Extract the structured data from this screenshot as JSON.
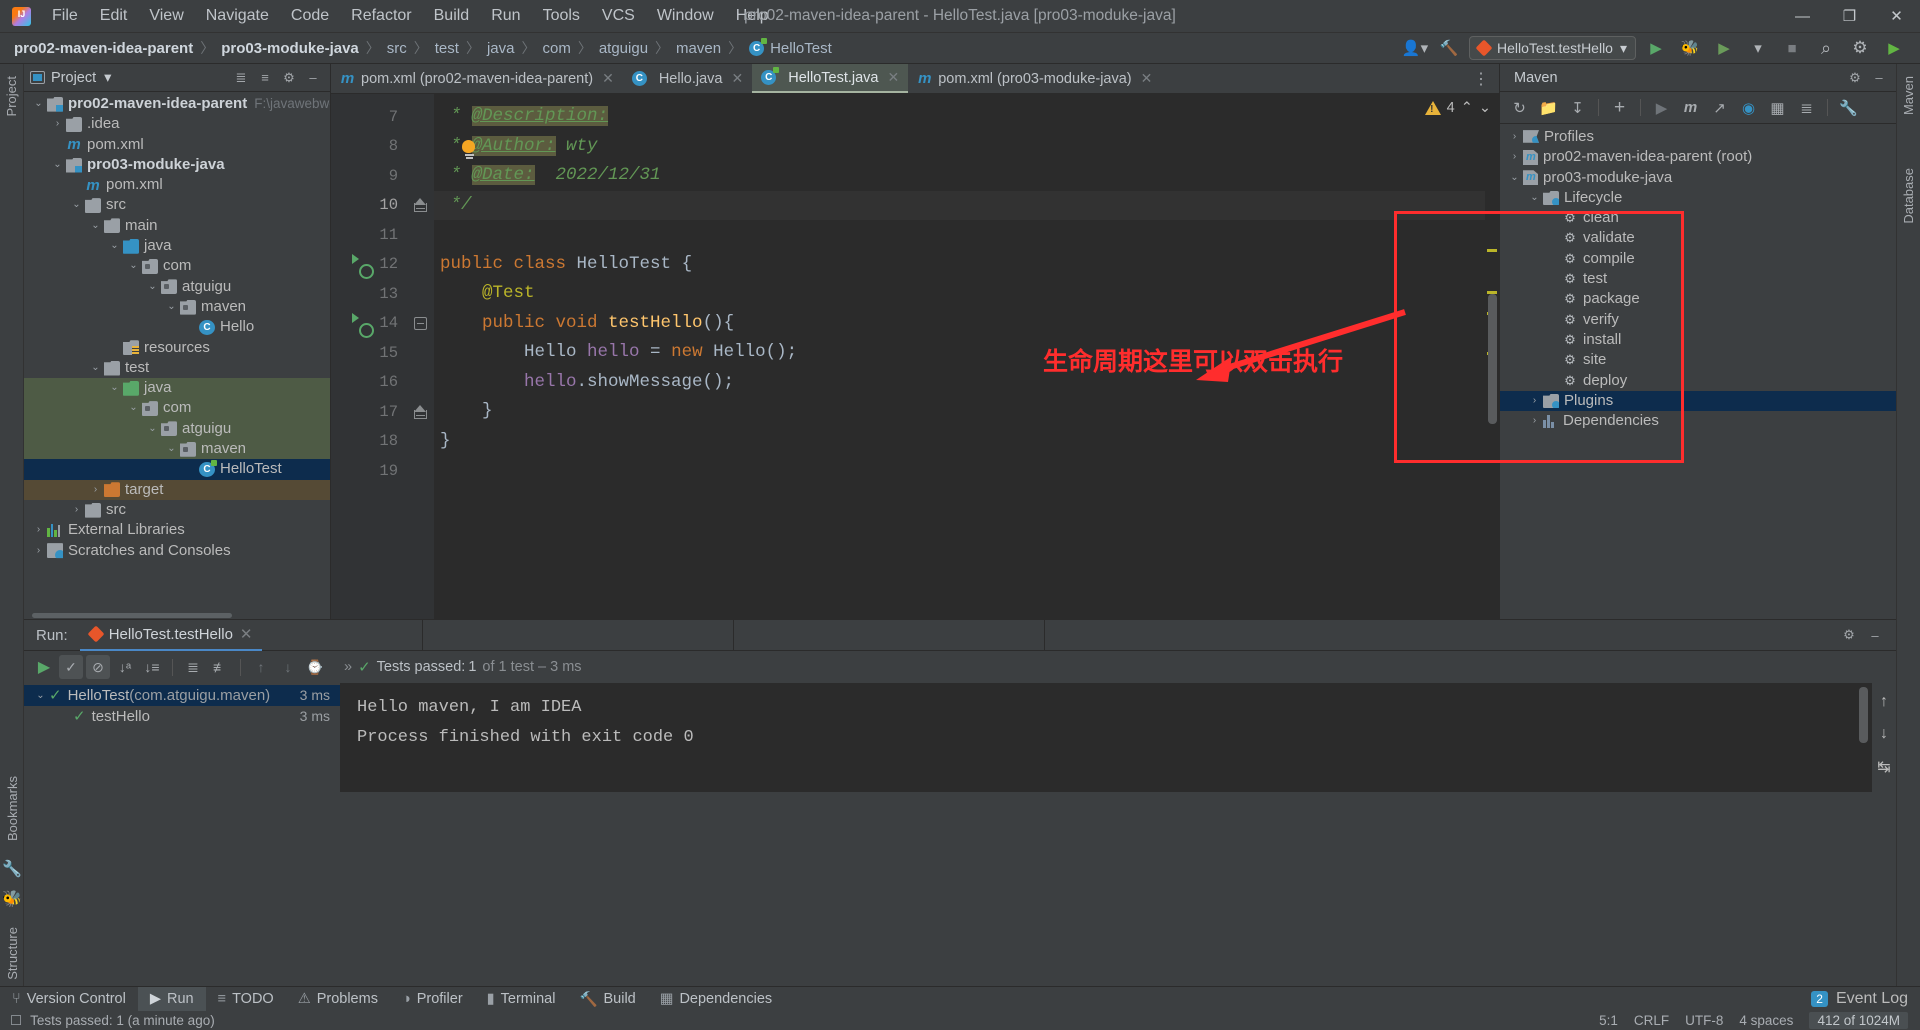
{
  "window": {
    "title": "pro02-maven-idea-parent - HelloTest.java [pro03-moduke-java]",
    "minimize": "—",
    "maximize": "❐",
    "close": "✕"
  },
  "menubar": {
    "items": [
      "File",
      "Edit",
      "View",
      "Navigate",
      "Code",
      "Refactor",
      "Build",
      "Run",
      "Tools",
      "VCS",
      "Window",
      "Help"
    ]
  },
  "navbar": {
    "crumbs": [
      "pro02-maven-idea-parent",
      "pro03-moduke-java",
      "src",
      "test",
      "java",
      "com",
      "atguigu",
      "maven",
      "HelloTest"
    ],
    "separator": "〉",
    "run_config": "HelloTest.testHello",
    "icons": {
      "profile": "user-icon",
      "build": "hammer-icon",
      "run": "▶",
      "debug": "debug-icon",
      "run_coverage": "coverage-icon",
      "more": "▾",
      "stop": "■",
      "search": "⌕",
      "settings": "⚙"
    }
  },
  "left_strip": {
    "top_label": "Project",
    "bottom_labels": [
      "Structure",
      "Bookmarks"
    ]
  },
  "right_strip": {
    "labels": [
      "Maven",
      "Database"
    ]
  },
  "project_panel": {
    "title": "Project",
    "dropdown": "▾",
    "actions": [
      "collapse-all-icon",
      "expand-all-icon",
      "settings-icon",
      "hide-icon"
    ],
    "tree": [
      {
        "depth": 0,
        "chev": "⌄",
        "icon": "module",
        "label": "pro02-maven-idea-parent",
        "bold": true,
        "path": "F:\\javawebwork\\",
        "state": ""
      },
      {
        "depth": 1,
        "chev": "›",
        "icon": "folder",
        "label": ".idea",
        "bold": false,
        "path": "",
        "state": ""
      },
      {
        "depth": 1,
        "chev": "",
        "icon": "maven-pom",
        "label": "pom.xml",
        "bold": false,
        "path": "",
        "state": ""
      },
      {
        "depth": 1,
        "chev": "⌄",
        "icon": "module",
        "label": "pro03-moduke-java",
        "bold": true,
        "path": "",
        "state": ""
      },
      {
        "depth": 2,
        "chev": "",
        "icon": "maven-pom",
        "label": "pom.xml",
        "bold": false,
        "path": "",
        "state": ""
      },
      {
        "depth": 2,
        "chev": "⌄",
        "icon": "folder",
        "label": "src",
        "bold": false,
        "path": "",
        "state": ""
      },
      {
        "depth": 3,
        "chev": "⌄",
        "icon": "folder",
        "label": "main",
        "bold": false,
        "path": "",
        "state": ""
      },
      {
        "depth": 4,
        "chev": "⌄",
        "icon": "folder-blue",
        "label": "java",
        "bold": false,
        "path": "",
        "state": ""
      },
      {
        "depth": 5,
        "chev": "⌄",
        "icon": "package",
        "label": "com",
        "bold": false,
        "path": "",
        "state": ""
      },
      {
        "depth": 6,
        "chev": "⌄",
        "icon": "package",
        "label": "atguigu",
        "bold": false,
        "path": "",
        "state": ""
      },
      {
        "depth": 7,
        "chev": "⌄",
        "icon": "package",
        "label": "maven",
        "bold": false,
        "path": "",
        "state": ""
      },
      {
        "depth": 8,
        "chev": "",
        "icon": "class",
        "label": "Hello",
        "bold": false,
        "path": "",
        "state": ""
      },
      {
        "depth": 4,
        "chev": "",
        "icon": "resources",
        "label": "resources",
        "bold": false,
        "path": "",
        "state": ""
      },
      {
        "depth": 3,
        "chev": "⌄",
        "icon": "folder",
        "label": "test",
        "bold": false,
        "path": "",
        "state": ""
      },
      {
        "depth": 4,
        "chev": "⌄",
        "icon": "folder-green",
        "label": "java",
        "bold": false,
        "path": "",
        "state": "green"
      },
      {
        "depth": 5,
        "chev": "⌄",
        "icon": "package",
        "label": "com",
        "bold": false,
        "path": "",
        "state": "green"
      },
      {
        "depth": 6,
        "chev": "⌄",
        "icon": "package",
        "label": "atguigu",
        "bold": false,
        "path": "",
        "state": "green"
      },
      {
        "depth": 7,
        "chev": "⌄",
        "icon": "package",
        "label": "maven",
        "bold": false,
        "path": "",
        "state": "green"
      },
      {
        "depth": 8,
        "chev": "",
        "icon": "class-test",
        "label": "HelloTest",
        "bold": false,
        "path": "",
        "state": "sel"
      },
      {
        "depth": 3,
        "chev": "›",
        "icon": "folder-orange",
        "label": "target",
        "bold": false,
        "path": "",
        "state": "brown"
      },
      {
        "depth": 2,
        "chev": "›",
        "icon": "folder",
        "label": "src",
        "bold": false,
        "path": "",
        "state": ""
      },
      {
        "depth": 0,
        "chev": "›",
        "icon": "libraries",
        "label": "External Libraries",
        "bold": false,
        "path": "",
        "state": ""
      },
      {
        "depth": 0,
        "chev": "›",
        "icon": "scratches",
        "label": "Scratches and Consoles",
        "bold": false,
        "path": "",
        "state": ""
      }
    ]
  },
  "editor": {
    "tabs": [
      {
        "label": "pom.xml (pro02-maven-idea-parent)",
        "icon": "maven-pom",
        "active": false,
        "close": "✕"
      },
      {
        "label": "Hello.java",
        "icon": "class",
        "active": false,
        "close": "✕"
      },
      {
        "label": "HelloTest.java",
        "icon": "class-test",
        "active": true,
        "close": "✕"
      },
      {
        "label": "pom.xml (pro03-moduke-java)",
        "icon": "maven-pom",
        "active": false,
        "close": "✕"
      }
    ],
    "tab_overflow": "⋮",
    "warning_count": "4",
    "warning_up": "⌃",
    "warning_down": "⌄",
    "lines": [
      {
        "num": "7",
        "mark": "",
        "fold": "",
        "highlight": false
      },
      {
        "num": "8",
        "mark": "",
        "fold": "",
        "highlight": false
      },
      {
        "num": "9",
        "mark": "",
        "fold": "",
        "highlight": false
      },
      {
        "num": "10",
        "mark": "",
        "fold": "foldtop",
        "highlight": true
      },
      {
        "num": "11",
        "mark": "",
        "fold": "",
        "highlight": false
      },
      {
        "num": "12",
        "mark": "run",
        "fold": "",
        "highlight": false
      },
      {
        "num": "13",
        "mark": "",
        "fold": "",
        "highlight": false
      },
      {
        "num": "14",
        "mark": "run",
        "fold": "minus",
        "highlight": false
      },
      {
        "num": "15",
        "mark": "",
        "fold": "",
        "highlight": false
      },
      {
        "num": "16",
        "mark": "",
        "fold": "",
        "highlight": false
      },
      {
        "num": "17",
        "mark": "",
        "fold": "foldtop",
        "highlight": false
      },
      {
        "num": "18",
        "mark": "",
        "fold": "",
        "highlight": false
      },
      {
        "num": "19",
        "mark": "",
        "fold": "",
        "highlight": false
      }
    ],
    "code": {
      "l7_star": " * ",
      "l7_tag": "@Description:",
      "l8_star": " * ",
      "l8_tag": "@Author:",
      "l8_val": " wty",
      "l9_star": " * ",
      "l9_tag": "@Date:",
      "l9_val": "  2022/12/31",
      "l10": " */",
      "l12_kw1": "public ",
      "l12_kw2": "class ",
      "l12_cls": "HelloTest ",
      "l12_brace": "{",
      "l13_ann": "    @Test",
      "l14_kw1": "    public ",
      "l14_kw2": "void ",
      "l14_mth": "testHello",
      "l14_rest": "(){",
      "l15_cls": "        Hello ",
      "l15_fld": "hello ",
      "l15_eq": "= ",
      "l15_kw": "new ",
      "l15_new": "Hello();",
      "l16_fld": "        hello",
      "l16_rest": ".showMessage();",
      "l17": "    }",
      "l18": "}"
    }
  },
  "annotation": {
    "text": "生命周期这里可以双击执行",
    "color": "#ff2d2d"
  },
  "maven_panel": {
    "title": "Maven",
    "toolbar": [
      "reload-icon",
      "reload-project-icon",
      "download-sources-icon",
      "add-icon",
      "run-icon",
      "maven-goal-icon",
      "skip-tests-icon",
      "execute-icon",
      "toggle-offline-icon",
      "show-diagram-icon",
      "settings-icon"
    ],
    "head_actions": [
      "settings-icon",
      "hide-icon"
    ],
    "tree": [
      {
        "depth": 0,
        "chev": "›",
        "icon": "profiles",
        "label": "Profiles",
        "state": ""
      },
      {
        "depth": 0,
        "chev": "›",
        "icon": "maven-project",
        "label": "pro02-maven-idea-parent (root)",
        "state": ""
      },
      {
        "depth": 0,
        "chev": "⌄",
        "icon": "maven-project",
        "label": "pro03-moduke-java",
        "state": ""
      },
      {
        "depth": 1,
        "chev": "⌄",
        "icon": "lifecycle",
        "label": "Lifecycle",
        "state": ""
      },
      {
        "depth": 2,
        "chev": "",
        "icon": "goal",
        "label": "clean",
        "state": ""
      },
      {
        "depth": 2,
        "chev": "",
        "icon": "goal",
        "label": "validate",
        "state": ""
      },
      {
        "depth": 2,
        "chev": "",
        "icon": "goal",
        "label": "compile",
        "state": ""
      },
      {
        "depth": 2,
        "chev": "",
        "icon": "goal",
        "label": "test",
        "state": ""
      },
      {
        "depth": 2,
        "chev": "",
        "icon": "goal",
        "label": "package",
        "state": ""
      },
      {
        "depth": 2,
        "chev": "",
        "icon": "goal",
        "label": "verify",
        "state": ""
      },
      {
        "depth": 2,
        "chev": "",
        "icon": "goal",
        "label": "install",
        "state": ""
      },
      {
        "depth": 2,
        "chev": "",
        "icon": "goal",
        "label": "site",
        "state": ""
      },
      {
        "depth": 2,
        "chev": "",
        "icon": "goal",
        "label": "deploy",
        "state": ""
      },
      {
        "depth": 1,
        "chev": "›",
        "icon": "plugins",
        "label": "Plugins",
        "state": "sel"
      },
      {
        "depth": 1,
        "chev": "›",
        "icon": "dependencies",
        "label": "Dependencies",
        "state": ""
      }
    ]
  },
  "run_panel": {
    "label": "Run:",
    "tab": "HelloTest.testHello",
    "tab_close": "✕",
    "head_actions": [
      "settings-icon",
      "hide-icon"
    ],
    "toolbar": {
      "rerun": "▶",
      "show_passed": "✓",
      "ignore": "⊘",
      "sort_alpha": "sort-alphabetically-icon",
      "sort_duration": "sort-by-duration-icon",
      "expand_all": "expand-all-icon",
      "collapse_all": "collapse-all-icon",
      "prev": "↑",
      "next": "↓",
      "history": "history-icon",
      "more": "»"
    },
    "status_check": "✓",
    "status_bold": "Tests passed:",
    "status_rest": " 1",
    "status_dim": " of 1 test – 3 ms",
    "tests": [
      {
        "depth": 0,
        "chev": "⌄",
        "check": "✓",
        "name": "HelloTest",
        "pkg": " (com.atguigu.maven)",
        "ms": "3 ms",
        "sel": true
      },
      {
        "depth": 1,
        "chev": "",
        "check": "✓",
        "name": "testHello",
        "pkg": "",
        "ms": "3 ms",
        "sel": false
      }
    ],
    "console": [
      "Hello maven, I am IDEA",
      "",
      "Process finished with exit code 0"
    ],
    "console_side": [
      "↑",
      "↓",
      "wrap-icon",
      "print-icon",
      "»"
    ]
  },
  "bottom_bar": {
    "items": [
      {
        "label": "Version Control",
        "icon": "branch-icon",
        "active": false
      },
      {
        "label": "Run",
        "icon": "▶",
        "active": true
      },
      {
        "label": "TODO",
        "icon": "todo-icon",
        "active": false
      },
      {
        "label": "Problems",
        "icon": "problems-icon",
        "active": false
      },
      {
        "label": "Profiler",
        "icon": "profiler-icon",
        "active": false
      },
      {
        "label": "Terminal",
        "icon": "terminal-icon",
        "active": false
      },
      {
        "label": "Build",
        "icon": "build-icon",
        "active": false
      },
      {
        "label": "Dependencies",
        "icon": "dependencies-icon",
        "active": false
      }
    ],
    "event_log": {
      "count": "2",
      "label": "Event Log"
    }
  },
  "status_bar": {
    "message": "Tests passed: 1 (a minute ago)",
    "caret": "5:1",
    "line_sep": "CRLF",
    "encoding": "UTF-8",
    "indent": "4 spaces",
    "memory": "412 of 1024M"
  }
}
